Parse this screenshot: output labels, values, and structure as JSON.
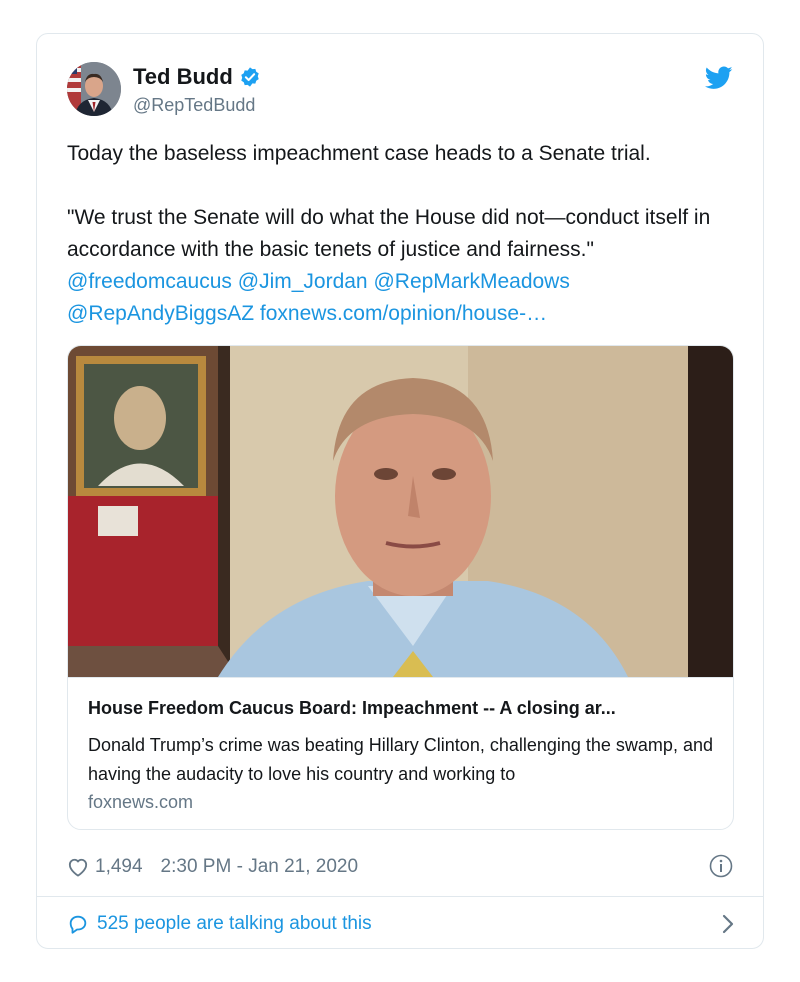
{
  "author": {
    "display_name": "Ted Budd",
    "handle": "@RepTedBudd",
    "verified": true
  },
  "tweet": {
    "line1": "Today the baseless impeachment case heads to a Senate trial.",
    "quote": "\"We trust the Senate will do what the House did not—conduct itself in accordance with the basic tenets of justice and fairness.\"",
    "mentions": [
      "@freedomcaucus",
      "@Jim_Jordan",
      "@RepMarkMeadows",
      "@RepAndyBiggsAZ"
    ],
    "link": "foxnews.com/opinion/house-…"
  },
  "card": {
    "title": "House Freedom Caucus Board: Impeachment -- A closing ar...",
    "description": "Donald Trump’s crime was beating Hillary Clinton, challenging the swamp, and having the audacity to love his country and working to",
    "domain": "foxnews.com"
  },
  "meta": {
    "likes": "1,494",
    "timestamp": "2:30 PM - Jan 21, 2020"
  },
  "footer": {
    "talking": "525 people are talking about this"
  },
  "colors": {
    "link": "#1b95e0",
    "secondary_text": "#657786",
    "border": "#e1e8ed",
    "verified": "#1da1f2"
  },
  "icons": [
    "twitter-bird-icon",
    "verified-badge-icon",
    "heart-icon",
    "info-icon",
    "speech-bubble-icon",
    "chevron-right-icon"
  ]
}
